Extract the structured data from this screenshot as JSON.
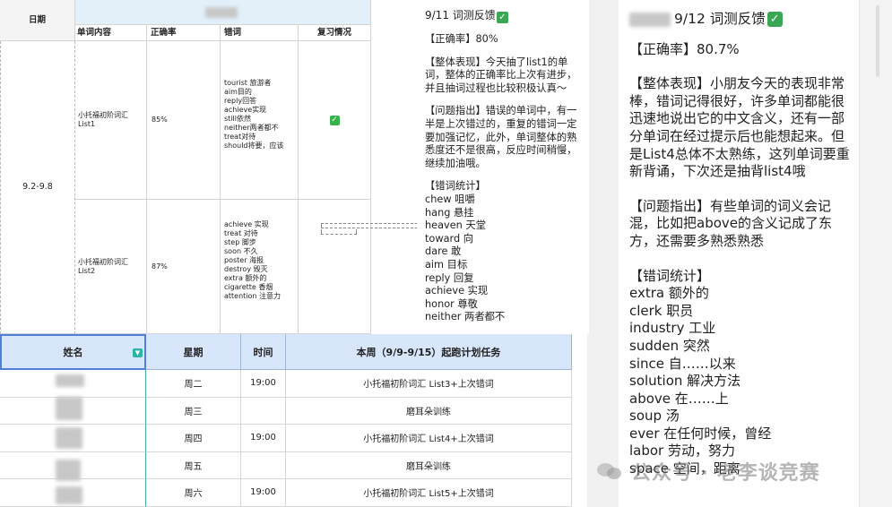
{
  "top_sheet": {
    "date_header": "日期",
    "col_headers": {
      "content": "单词内容",
      "accuracy": "正确率",
      "errors": "错词",
      "review": "复习情况"
    },
    "date_range": "9.2-9.8",
    "rows": [
      {
        "content": "小托福初阶词汇 List1",
        "accuracy": "85%",
        "errors": [
          "tourist 旅游者",
          "aim目的",
          "reply回答",
          "achieve实现",
          "still依然",
          "neither两者都不",
          "treat对待",
          "should将要，应该"
        ],
        "review_icon": "green-check-icon"
      },
      {
        "content": "小托福初阶词汇 List2",
        "accuracy": "87%",
        "errors": [
          "achieve 实现",
          "treat 对待",
          "step 脚步",
          "soon 不久",
          "poster 海报",
          "destroy 毁灭",
          "extra 额外的",
          "cigarette 香烟",
          "attention 注意力"
        ],
        "review_icon": ""
      }
    ]
  },
  "card_911": {
    "title": "9/11 词测反馈",
    "accuracy": "【正确率】80%",
    "overall": "【整体表现】今天抽了list1的单词，整体的正确率比上次有进步，并且抽词过程也比较积极认真～",
    "issues": "【问题指出】错误的单词中，有一半是上次错过的，重复的错词一定要加强记忆，此外，单词整体的熟悉度还不是很高，反应时间稍慢，继续加油哦。",
    "stats_title": "【错词统计】",
    "stats": [
      "chew 咀嚼",
      "hang 悬挂",
      "heaven 天堂",
      "toward 向",
      "dare 敢",
      "aim 目标",
      "reply 回复",
      "achieve 实现",
      "honor 尊敬",
      "neither 两者都不"
    ]
  },
  "card_912": {
    "title": "9/12 词测反馈",
    "accuracy": "【正确率】80.7%",
    "overall": "【整体表现】小朋友今天的表现非常棒，错词记得很好，许多单词都能很迅速地说出它的中文含义，还有一部分单词在经过提示后也能想起来。但是List4总体不太熟练，这列单词要重新背诵，下次还是抽背list4哦",
    "issues": "【问题指出】有些单词的词义会记混，比如把above的含义记成了东方，还需要多熟悉熟悉",
    "stats_title": "【错词统计】",
    "stats": [
      "extra 额外的",
      "clerk 职员",
      "industry 工业",
      "sudden 突然",
      "since 自……以来",
      "solution 解决方法",
      "above 在……上",
      "soup 汤",
      "ever 在任何时候，曾经",
      "labor 劳动，努力",
      "space 空间，距离"
    ]
  },
  "schedule": {
    "headers": {
      "name": "姓名",
      "weekday": "星期",
      "time": "时间",
      "task": "本周（9/9-9/15）起跑计划任务"
    },
    "rows": [
      {
        "weekday": "周二",
        "time": "19:00",
        "task": "小托福初阶词汇 List3+上次错词"
      },
      {
        "weekday": "周三",
        "time": "",
        "task": "磨耳朵训练"
      },
      {
        "weekday": "周四",
        "time": "19:00",
        "task": "小托福初阶词汇 List4+上次错词"
      },
      {
        "weekday": "周五",
        "time": "",
        "task": "磨耳朵训练"
      },
      {
        "weekday": "周六",
        "time": "19:00",
        "task": "小托福初阶词汇 List5+上次错词"
      }
    ]
  },
  "watermark": "公众号 · 老李谈竞赛",
  "colors": {
    "header_blue": "#d8e6fb",
    "check_green": "#3aa755",
    "filter_teal": "#2bb3a3"
  }
}
